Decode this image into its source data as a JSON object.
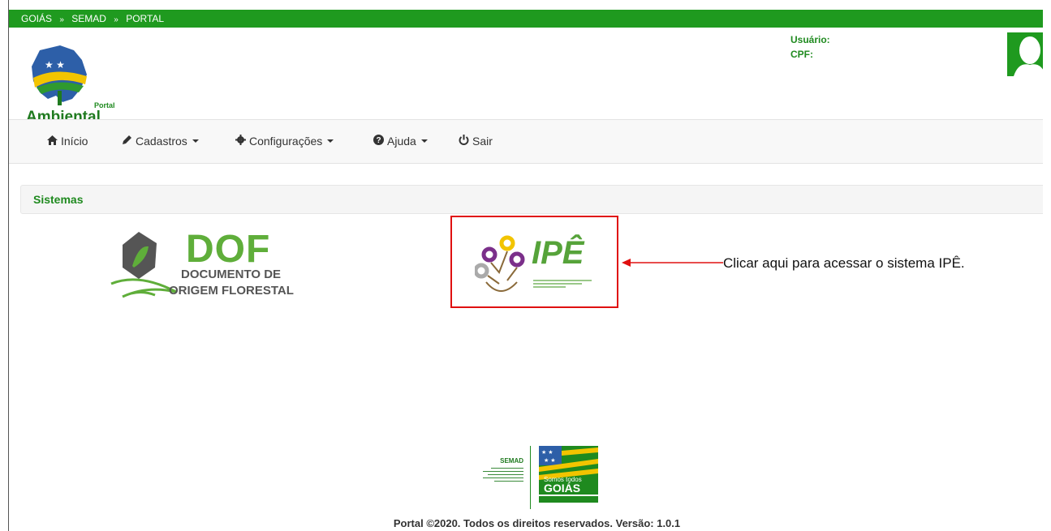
{
  "topbar": {
    "crumbs": [
      "GOIÁS",
      "SEMAD",
      "PORTAL"
    ],
    "separator": "»"
  },
  "logo": {
    "small": "Portal",
    "big": "Ambiental"
  },
  "user": {
    "usuario_label": "Usuário:",
    "cpf_label": "CPF:"
  },
  "nav": {
    "items": [
      {
        "label": "Início",
        "icon": "home-icon"
      },
      {
        "label": "Cadastros",
        "icon": "pencil-icon"
      },
      {
        "label": "Configurações",
        "icon": "gear-icon"
      },
      {
        "label": "Ajuda",
        "icon": "question-circle-icon"
      },
      {
        "label": "Sair",
        "icon": "power-icon"
      }
    ]
  },
  "panel": {
    "title": "Sistemas"
  },
  "dof": {
    "big": "DOF",
    "line1": "DOCUMENTO DE",
    "line2": "ORIGEM FLORESTAL"
  },
  "ipe": {
    "word": "IPÊ"
  },
  "callout": {
    "text": "Clicar aqui para acessar o sistema IPÊ."
  },
  "footer": {
    "semad": "SEMAD",
    "goias_top": "Somos todos",
    "goias_word": "GOIÁS",
    "copyright": "Portal ©2020. Todos os direitos reservados. Versão: 1.0.1"
  },
  "colors": {
    "green": "#1f9a1f",
    "text_green": "#1f8a1f",
    "callout_red": "#e01010"
  }
}
